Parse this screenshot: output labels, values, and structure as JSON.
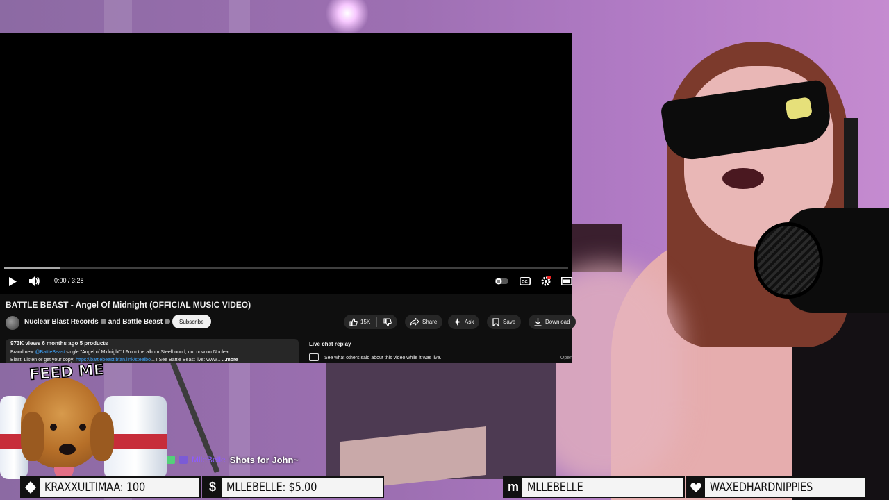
{
  "video_player": {
    "current_time": "0:00",
    "duration": "3:28",
    "time_display": "0:00 / 3:28",
    "progress_fraction": 0.1,
    "icons": [
      "play-icon",
      "volume-icon",
      "autoplay-icon",
      "captions-icon",
      "settings-icon",
      "theater-icon"
    ]
  },
  "video": {
    "title": "BATTLE BEAST - Angel Of Midnight (OFFICIAL MUSIC VIDEO)",
    "channel": "Nuclear Blast Records",
    "channel_joiner": "and",
    "collab_channel": "Battle Beast",
    "subscribe_label": "Subscribe",
    "like_count": "15K",
    "share_label": "Share",
    "ask_label": "Ask",
    "save_label": "Save",
    "download_label": "Download"
  },
  "description": {
    "meta": "973K views  6 months ago  5 products",
    "line1_prefix": "Brand new ",
    "line1_mention": "@BattleBeast",
    "line1_text": " single \"Angel of Midnight\" I From the album Steelbound, out now on Nuclear",
    "line2_text": "Blast. Listen or get your copy: ",
    "line2_link": "https://battlebeast.bfan.link/steelbo",
    "line2_rest": "...  I See Battle Beast live: www...",
    "more_label": "...more"
  },
  "live_chat": {
    "title": "Live chat replay",
    "subtitle": "See what others said about this video while it was live.",
    "open_label": "Open"
  },
  "stream_overlay": {
    "feed_label": "FEED ME",
    "shoutout_user": "MlleBelle",
    "shoutout_text": "Shots for John~",
    "events": [
      {
        "icon": "diamond-icon",
        "text": "KRAXXULTIMAA: 100"
      },
      {
        "icon": "dollar-icon",
        "text": "MLLEBELLE: $5.00"
      },
      {
        "icon": "m-logo-icon",
        "text": "MLLEBELLE"
      },
      {
        "icon": "heart-icon",
        "text": "WAXEDHARDNIPPIES"
      }
    ]
  },
  "colors": {
    "youtube_bg": "#0f0f0f",
    "pill_bg": "#272727",
    "link": "#3ea6ff",
    "wall_purple": "#9d6fb2",
    "event_bar_bg": "#f4f4f4"
  }
}
